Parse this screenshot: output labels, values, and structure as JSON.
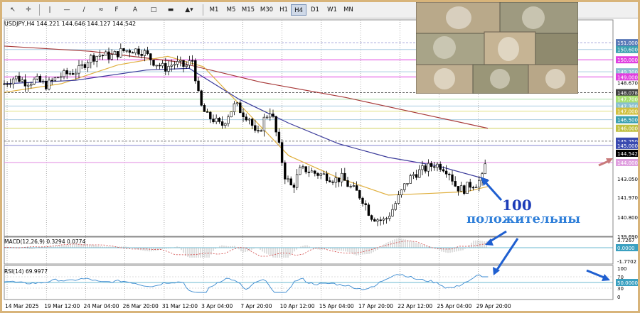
{
  "toolbar": {
    "tools": [
      "crosshair-tool",
      "horizontal-line-tool",
      "trendline-tool",
      "channel-tool",
      "fibonacci-tool",
      "text-tool",
      "label-tool",
      "rectangle-tool",
      "shapes-tool"
    ],
    "timeframes": [
      "M1",
      "M5",
      "M15",
      "M30",
      "H1",
      "H4",
      "D1",
      "W1",
      "MN"
    ],
    "active_timeframe": "H4"
  },
  "symbol_header": "USDJPY,H4  144.221 144.646 144.127 144.542",
  "macd_label": "MACD(12,26,9) 0.3294 0.0774",
  "rsi_label": "RSI(14) 69.9977",
  "annotation": {
    "number": "100",
    "word": "положительны"
  },
  "colors": {
    "bull": "#ffffff",
    "bear": "#000000",
    "ma_blue": "#3a3a9a",
    "ma_red": "#a83a3a",
    "ma_gold": "#e0b040",
    "arrow": "#1f5fd0",
    "pink_arrow": "#c87a7a",
    "rsi_line": "#3a8ad0",
    "macd_hist": "#a0a0a0",
    "macd_signal": "#d04040"
  },
  "chart_data": {
    "type": "candlestick",
    "symbol": "USDJPY",
    "timeframe": "H4",
    "last": {
      "open": 144.221,
      "high": 144.646,
      "low": 144.127,
      "close": 144.542
    },
    "y_range": [
      139.69,
      151.75
    ],
    "x_ticks": [
      "14 Mar 2025",
      "19 Mar 12:00",
      "24 Mar 04:00",
      "26 Mar 20:00",
      "31 Mar 12:00",
      "3 Apr 04:00",
      "7 Apr 20:00",
      "10 Apr 12:00",
      "15 Apr 04:00",
      "17 Apr 20:00",
      "22 Apr 12:00",
      "25 Apr 04:00",
      "29 Apr 20:00"
    ],
    "close_path": [
      [
        0,
        148.6
      ],
      [
        15,
        149.0
      ],
      [
        30,
        148.7
      ],
      [
        45,
        148.8
      ],
      [
        60,
        148.5
      ],
      [
        75,
        149.0
      ],
      [
        90,
        149.2
      ],
      [
        105,
        149.4
      ],
      [
        120,
        150.1
      ],
      [
        135,
        150.3
      ],
      [
        150,
        150.2
      ],
      [
        165,
        150.5
      ],
      [
        180,
        150.6
      ],
      [
        195,
        150.5
      ],
      [
        210,
        149.9
      ],
      [
        225,
        149.5
      ],
      [
        240,
        149.8
      ],
      [
        255,
        149.6
      ],
      [
        265,
        150.0
      ],
      [
        275,
        147.4
      ],
      [
        285,
        146.7
      ],
      [
        295,
        146.5
      ],
      [
        305,
        146.1
      ],
      [
        315,
        146.8
      ],
      [
        325,
        147.4
      ],
      [
        335,
        146.9
      ],
      [
        345,
        146.6
      ],
      [
        355,
        145.4
      ],
      [
        365,
        146.5
      ],
      [
        375,
        147.1
      ],
      [
        385,
        145.2
      ],
      [
        395,
        143.2
      ],
      [
        405,
        142.5
      ],
      [
        415,
        143.5
      ],
      [
        425,
        143.6
      ],
      [
        435,
        143.4
      ],
      [
        445,
        143.3
      ],
      [
        455,
        143.2
      ],
      [
        465,
        143.0
      ],
      [
        475,
        143.1
      ],
      [
        485,
        142.6
      ],
      [
        495,
        142.3
      ],
      [
        505,
        141.8
      ],
      [
        515,
        140.9
      ],
      [
        525,
        140.7
      ],
      [
        535,
        140.6
      ],
      [
        545,
        141.2
      ],
      [
        555,
        142.0
      ],
      [
        565,
        142.8
      ],
      [
        575,
        143.3
      ],
      [
        585,
        143.5
      ],
      [
        595,
        143.7
      ],
      [
        605,
        143.9
      ],
      [
        615,
        143.8
      ],
      [
        625,
        143.5
      ],
      [
        635,
        142.6
      ],
      [
        645,
        142.4
      ],
      [
        655,
        142.7
      ],
      [
        665,
        142.8
      ],
      [
        672,
        143.1
      ],
      [
        680,
        144.5
      ]
    ],
    "ma_blue": [
      [
        0,
        148.6
      ],
      [
        100,
        148.8
      ],
      [
        200,
        149.4
      ],
      [
        260,
        149.5
      ],
      [
        330,
        147.7
      ],
      [
        400,
        146.3
      ],
      [
        470,
        145.1
      ],
      [
        540,
        144.3
      ],
      [
        610,
        143.8
      ],
      [
        680,
        143.0
      ]
    ],
    "ma_red": [
      [
        0,
        150.8
      ],
      [
        120,
        150.5
      ],
      [
        240,
        149.9
      ],
      [
        360,
        148.7
      ],
      [
        480,
        147.8
      ],
      [
        580,
        146.9
      ],
      [
        680,
        146.0
      ]
    ],
    "ma_gold": [
      [
        0,
        148.1
      ],
      [
        80,
        148.6
      ],
      [
        160,
        149.7
      ],
      [
        230,
        150.2
      ],
      [
        280,
        149.6
      ],
      [
        340,
        147.0
      ],
      [
        400,
        144.4
      ],
      [
        470,
        143.1
      ],
      [
        540,
        142.1
      ],
      [
        600,
        142.2
      ],
      [
        650,
        142.3
      ],
      [
        680,
        142.6
      ]
    ],
    "levels": [
      {
        "value": 151.0,
        "label": "151.000",
        "color": "#8a8ad0",
        "box": "#5a7ab8",
        "style": "dash"
      },
      {
        "value": 150.6,
        "label": "150.600",
        "color": "#a8cce0",
        "box": "#3aa0b0",
        "style": "solid"
      },
      {
        "value": 150.0,
        "label": "150.000",
        "color": "#e040e0",
        "box": "#e040e0",
        "style": "solid"
      },
      {
        "value": 149.3,
        "label": "149.300",
        "color": "#a8cce0",
        "box": "#8ac0d0",
        "style": "solid"
      },
      {
        "value": 149.0,
        "label": "149.000",
        "color": "#e040e0",
        "box": "#e040e0",
        "style": "solid"
      },
      {
        "value": 148.078,
        "label": "148.078",
        "color": "#333333",
        "box": "#404040",
        "style": "dash"
      },
      {
        "value": 147.7,
        "label": "147.700",
        "color": "#a8e0a8",
        "box": "#a8e070",
        "style": "solid"
      },
      {
        "value": 147.3,
        "label": "147.300",
        "color": "#a8cce0",
        "box": "#8ac0d0",
        "style": "solid"
      },
      {
        "value": 147.0,
        "label": "147.000",
        "color": "#e0e080",
        "box": "#d0c040",
        "style": "solid"
      },
      {
        "value": 146.5,
        "label": "146.500",
        "color": "#a8cce0",
        "box": "#3aa0b0",
        "style": "solid"
      },
      {
        "value": 146.0,
        "label": "146.000",
        "color": "#d0d060",
        "box": "#c0c040",
        "style": "solid"
      },
      {
        "value": 145.25,
        "label": "145.250",
        "color": "#555555",
        "box": "#3a4ab0",
        "style": "dash"
      },
      {
        "value": 145.0,
        "label": "145.000",
        "color": "#8888d0",
        "box": "#3a4ab0",
        "style": "solid"
      },
      {
        "value": 144.542,
        "label": "144.542",
        "color": "#000000",
        "box": "#000000",
        "style": "none"
      },
      {
        "value": 144.0,
        "label": "144.000",
        "color": "#e08ae0",
        "box": "#e0a0e0",
        "style": "solid"
      }
    ],
    "y_ticks": [
      "148.670",
      "143.050",
      "141.970",
      "140.800",
      "139.690"
    ],
    "macd": {
      "label": "MACD(12,26,9) 0.3294 0.0774",
      "y_ticks": [
        "3.7267",
        "0.0000",
        "-1.7702"
      ]
    },
    "rsi": {
      "label": "RSI(14) 69.9977",
      "y_ticks": [
        "100",
        "70",
        "50.0000",
        "30",
        "0"
      ],
      "last": 69.9977
    }
  }
}
